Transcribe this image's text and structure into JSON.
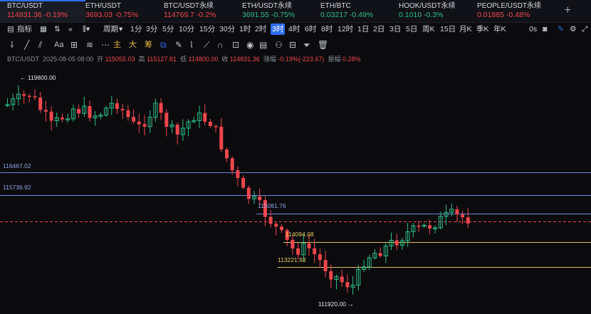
{
  "tickers": [
    {
      "name": "BTC/USDT",
      "value": "114831.36",
      "change": "-0.19%",
      "dir": "down",
      "active": true
    },
    {
      "name": "ETH/USDT",
      "value": "3693.03",
      "change": "-0.75%",
      "dir": "down"
    },
    {
      "name": "BTC/USDT永续",
      "value": "114769.7",
      "change": "-0.2%",
      "dir": "down"
    },
    {
      "name": "ETH/USDT永续",
      "value": "3691.55",
      "change": "-0.75%",
      "dir": "up"
    },
    {
      "name": "ETH/BTC",
      "value": "0.03217",
      "change": "-0.49%",
      "dir": "up"
    },
    {
      "name": "HOOK/USDT永续",
      "value": "0.1010",
      "change": "-0.3%",
      "dir": "up"
    },
    {
      "name": "PEOPLE/USDT永续",
      "value": "0.01885",
      "change": "-0.48%",
      "dir": "down"
    }
  ],
  "toolbar": {
    "indicator_label": "指标",
    "period_label": "周期",
    "timeframes": [
      "1分",
      "3分",
      "5分",
      "10分",
      "15分",
      "30分",
      "1时",
      "2时",
      "3时",
      "4时",
      "6时",
      "8时",
      "12时",
      "1日",
      "2日",
      "3日",
      "5日",
      "周K",
      "15日",
      "月K",
      "季K",
      "年K"
    ],
    "selected_timeframe": "3时",
    "zero_s": "0s",
    "main_label": "主",
    "big_label": "大",
    "chip_label": "筹"
  },
  "ohlc": {
    "symbol": "BTC/USDT",
    "date": "2025-08-05 08:00",
    "open_label": "开",
    "open": "115055.03",
    "high_label": "高",
    "high": "115127.81",
    "low_label": "低",
    "low": "114800.00",
    "close_label": "收",
    "close": "114831.36",
    "chg_label": "涨幅",
    "chg": "-0.19%(-223.67)",
    "amp_label": "振幅",
    "amp": "0.28%"
  },
  "levels": {
    "high_marker": "← 119800.00",
    "l1": "116467.02",
    "l2": "115736.92",
    "l3": "115081.76",
    "l4": "114094.08",
    "l5": "113221.93",
    "low_marker": "111920.00 →"
  },
  "colors": {
    "up": "#2ebd85",
    "down": "#f0464d",
    "accent": "#2f6df5",
    "blue_line": "#6b86d6",
    "yellow_line": "#d9c46a",
    "bg": "#0b0b0e"
  }
}
